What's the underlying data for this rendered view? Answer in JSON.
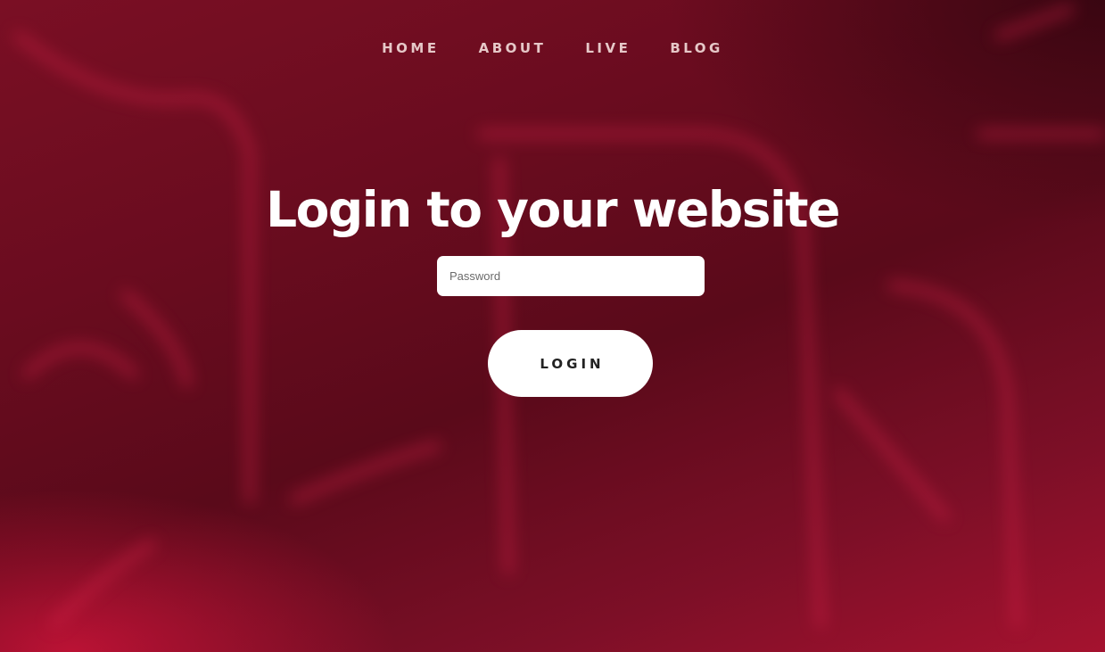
{
  "nav": {
    "items": [
      {
        "label": "HOME"
      },
      {
        "label": "ABOUT"
      },
      {
        "label": "LIVE"
      },
      {
        "label": "BLOG"
      }
    ]
  },
  "main": {
    "title": "Login to your website",
    "password_placeholder": "Password",
    "login_label": "LOGIN"
  },
  "colors": {
    "background_accent": "#a5122f",
    "background_dark": "#5a0a1a",
    "nav_text": "#e6c8c8",
    "title_text": "#ffffff",
    "button_background": "#ffffff",
    "button_text": "#222222"
  }
}
